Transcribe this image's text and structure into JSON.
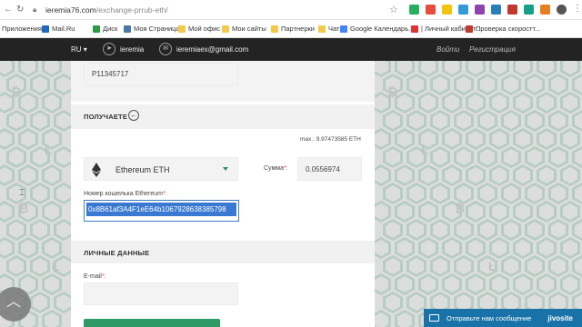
{
  "browser": {
    "url_domain": "ieremia76.com",
    "url_path": "/exchange-prrub-eth/"
  },
  "bookmarks": [
    {
      "label": "Приложения",
      "color": "#4a7fd6"
    },
    {
      "label": "Mail.Ru",
      "color": "#1f67b8"
    },
    {
      "label": "Диск",
      "color": "#2d9a47"
    },
    {
      "label": "Моя Страница",
      "color": "#4a76a8"
    },
    {
      "label": "Мой офис",
      "color": "#f2c94c"
    },
    {
      "label": "Мои сайты",
      "color": "#f2c94c"
    },
    {
      "label": "Партнерки",
      "color": "#f2c94c"
    },
    {
      "label": "Чаты",
      "color": "#f2c94c"
    },
    {
      "label": "Google Календарь...",
      "color": "#4285f4"
    },
    {
      "label": "| Личный кабинет...",
      "color": "#d33"
    },
    {
      "label": "Проверка скоростт...",
      "color": "#c0392b"
    }
  ],
  "header": {
    "lang": "RU",
    "telegram": "ieremia",
    "email": "ieremiaex@gmail.com",
    "login": "Войти",
    "register": "Регистрация"
  },
  "form": {
    "account_value": "P11345717",
    "receive_title": "ПОЛУЧАЕТЕ",
    "max_info": "max.: 9.97473585 ETH",
    "currency": "Ethereum ETH",
    "sum_label": "Сумма",
    "sum_value": "0.0556974",
    "wallet_label": "Номер кошелька Ethereum",
    "wallet_value": "0x8B61af3A4F1eE64b1067928638385798",
    "personal_title": "ЛИЧНЫЕ ДАННЫЕ",
    "email_label": "E-mail",
    "required_mark": "*:"
  },
  "chat": {
    "text": "Отправьте нам сообщение",
    "brand": "jivosite"
  },
  "colors": {
    "accent": "#2e9b66",
    "header_bg": "#232323",
    "selection": "#3a79d1"
  }
}
